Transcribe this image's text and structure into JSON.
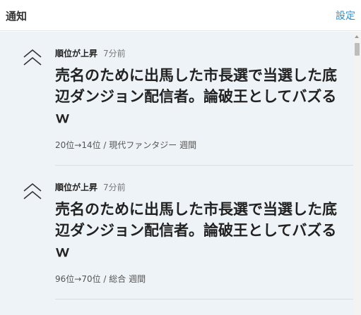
{
  "header": {
    "title": "通知",
    "settings_label": "設定"
  },
  "notifications": [
    {
      "icon": "double-chevron-up-icon",
      "label": "順位が上昇",
      "time": "7分前",
      "title": "売名のために出馬した市長選で当選した底辺ダンジョン配信者。論破王としてバズるｗ",
      "meta": "20位→14位 / 現代ファンタジー 週間"
    },
    {
      "icon": "double-chevron-up-icon",
      "label": "順位が上昇",
      "time": "7分前",
      "title": "売名のために出馬した市長選で当選した底辺ダンジョン配信者。論破王としてバズるｗ",
      "meta": "96位→70位 / 総合 週間"
    }
  ],
  "colors": {
    "accent": "#2b8fd6",
    "list_background": "#eef3f7"
  }
}
